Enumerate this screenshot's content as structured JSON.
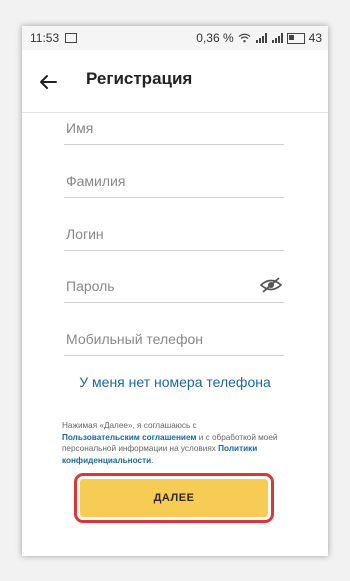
{
  "status_bar": {
    "time": "11:53",
    "data_speed": "0,36 %",
    "battery": "43",
    "icons": [
      "image-icon",
      "wifi-icon",
      "signal-icon",
      "battery-icon"
    ]
  },
  "header": {
    "title": "Регистрация",
    "back_icon": "arrow-back-icon"
  },
  "form": {
    "first_name": {
      "placeholder": "Имя",
      "value": ""
    },
    "last_name": {
      "placeholder": "Фамилия",
      "value": ""
    },
    "login": {
      "placeholder": "Логин",
      "value": ""
    },
    "password": {
      "placeholder": "Пароль",
      "value": "",
      "toggle_icon": "eye-off-icon"
    },
    "phone": {
      "placeholder": "Мобильный телефон",
      "value": ""
    }
  },
  "no_phone_link": "У меня нет номера телефона",
  "consent": {
    "text_1": "Нажимая «Далее», я соглашаюсь с",
    "user_agreement_link": "Пользовательским соглашением",
    "text_2": " и с обработкой моей персональной информации на условиях ",
    "privacy_link": "Политики конфиденциальности",
    "text_3": "."
  },
  "next_button": "ДАЛЕЕ",
  "colors": {
    "accent_link": "#1a66a8",
    "button": "#f6cc54",
    "highlight_frame": "#d9373c"
  }
}
